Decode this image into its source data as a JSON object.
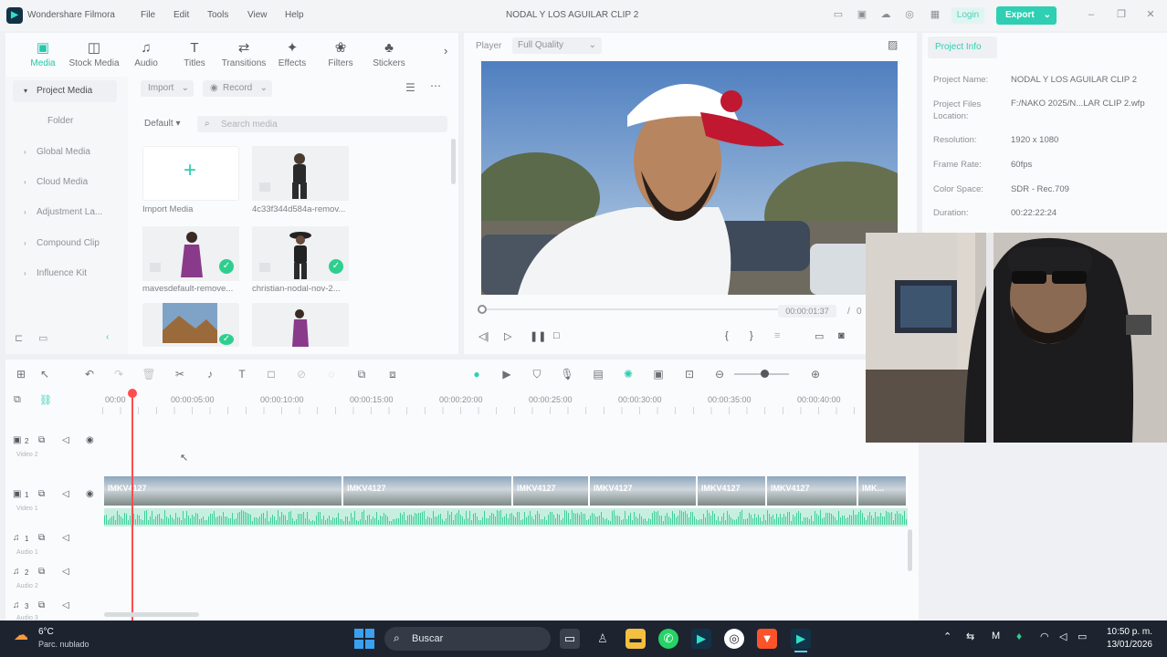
{
  "app": {
    "name": "Wondershare Filmora",
    "project_title": "NODAL Y LOS AGUILAR CLIP 2",
    "menu": [
      "File",
      "Edit",
      "Tools",
      "View",
      "Help"
    ],
    "login_label": "Login",
    "export_label": "Export"
  },
  "media_tabs": [
    "Media",
    "Stock Media",
    "Audio",
    "Titles",
    "Transitions",
    "Effects",
    "Filters",
    "Stickers"
  ],
  "sidebar": {
    "items": [
      "Project Media",
      "Folder",
      "Global Media",
      "Cloud Media",
      "Adjustment La...",
      "Compound Clip",
      "Influence Kit"
    ]
  },
  "media_toolbar": {
    "import_label": "Import",
    "record_label": "Record",
    "sort_label": "Default",
    "search_placeholder": "Search media"
  },
  "media_items": [
    {
      "label": "Import Media"
    },
    {
      "label": "4c33f344d584a-remov..."
    },
    {
      "label": "mavesdefault-remove..."
    },
    {
      "label": "christian-nodal-nov-2..."
    },
    {
      "label": ""
    },
    {
      "label": ""
    }
  ],
  "player": {
    "label": "Player",
    "quality": "Full Quality",
    "timecode": "00:00:01:37",
    "separator": "/",
    "duration_partial": "0"
  },
  "project_info": {
    "tab_label": "Project Info",
    "fields": [
      {
        "key": "Project Name:",
        "value": "NODAL Y LOS AGUILAR CLIP 2"
      },
      {
        "key": "Project Files Location:",
        "value": "F:/NAKO 2025/N...LAR CLIP 2.wfp"
      },
      {
        "key": "Resolution:",
        "value": "1920 x 1080"
      },
      {
        "key": "Frame Rate:",
        "value": "60fps"
      },
      {
        "key": "Color Space:",
        "value": "SDR - Rec.709"
      },
      {
        "key": "Duration:",
        "value": "00:22:22:24"
      }
    ]
  },
  "timeline": {
    "ruler": [
      "00:00",
      "00:00:05:00",
      "00:00:10:00",
      "00:00:15:00",
      "00:00:20:00",
      "00:00:25:00",
      "00:00:30:00",
      "00:00:35:00",
      "00:00:40:00"
    ],
    "tracks": [
      {
        "name": "Video 2"
      },
      {
        "name": "Video 1"
      },
      {
        "name": "Audio 1"
      },
      {
        "name": "Audio 2"
      },
      {
        "name": "Audio 3"
      }
    ],
    "track_numbers": [
      "2",
      "1",
      "1",
      "2",
      "3"
    ],
    "clips": [
      "IMKV4127",
      "IMKV4127",
      "IMKV4127",
      "IMKV4127",
      "IMKV4127",
      "IMKV4127",
      "IMK..."
    ]
  },
  "taskbar": {
    "weather_temp": "6°C",
    "weather_desc": "Parc. nublado",
    "search_label": "Buscar",
    "time": "10:50 p. m.",
    "date": "13/01/2026"
  },
  "colors": {
    "accent": "#2ecfb2",
    "playhead": "#ff4d4d",
    "audio_wave": "#3fcf9a"
  }
}
